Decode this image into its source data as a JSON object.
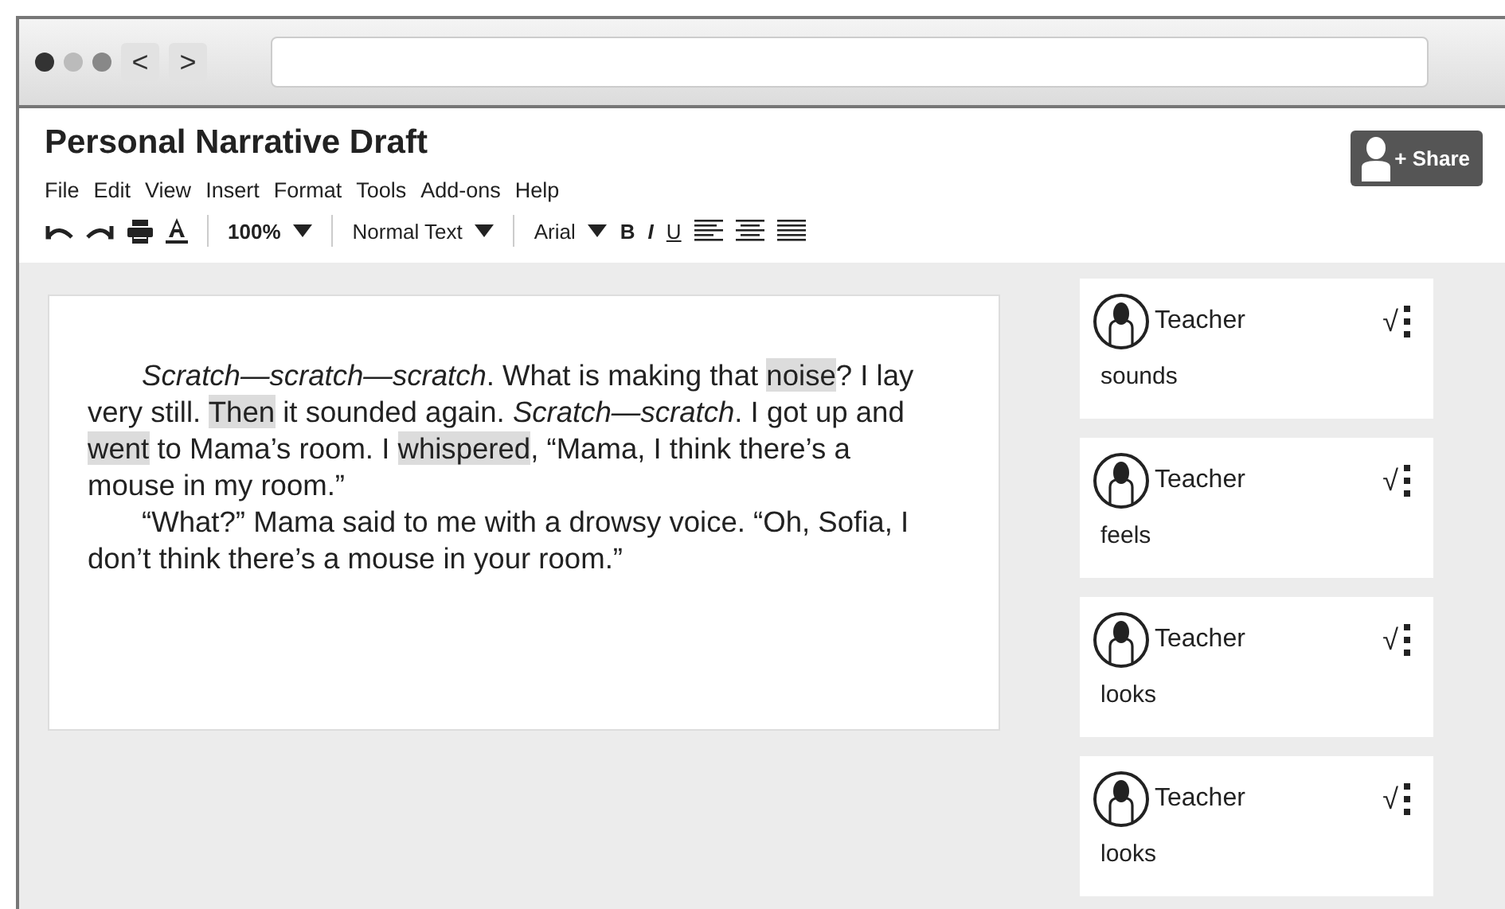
{
  "browser": {
    "back": "<",
    "forward": ">"
  },
  "document": {
    "title": "Personal Narrative Draft",
    "share": "+ Share",
    "menu": [
      "File",
      "Edit",
      "View",
      "Insert",
      "Format",
      "Tools",
      "Add-ons",
      "Help"
    ],
    "toolbar": {
      "zoom": "100%",
      "style": "Normal Text",
      "font": "Arial",
      "bold": "B",
      "italic": "I",
      "underline": "U"
    },
    "paragraphs": [
      [
        {
          "text": "Scratch—scratch—scratch",
          "kind": "italic"
        },
        {
          "text": ". What is making that ",
          "kind": "plain"
        },
        {
          "text": "noise",
          "kind": "highlight"
        },
        {
          "text": "? I lay very still. ",
          "kind": "plain"
        },
        {
          "text": "Then",
          "kind": "highlight"
        },
        {
          "text": " it sounded again. ",
          "kind": "plain"
        },
        {
          "text": "Scratch—scratch",
          "kind": "italic"
        },
        {
          "text": ". I got up and ",
          "kind": "plain"
        },
        {
          "text": "went",
          "kind": "highlight"
        },
        {
          "text": " to Mama’s room. I ",
          "kind": "plain"
        },
        {
          "text": "whispered",
          "kind": "highlight"
        },
        {
          "text": ", “Mama, I think there’s a mouse in my room.”",
          "kind": "plain"
        }
      ],
      [
        {
          "text": "“What?” Mama said to me with a drowsy voice. “Oh, Sofia, I don’t think there’s a mouse in your room.”",
          "kind": "plain"
        }
      ]
    ]
  },
  "comments": [
    {
      "author": "Teacher",
      "resolve": "√",
      "text": "sounds"
    },
    {
      "author": "Teacher",
      "resolve": "√",
      "text": "feels"
    },
    {
      "author": "Teacher",
      "resolve": "√",
      "text": "looks"
    },
    {
      "author": "Teacher",
      "resolve": "√",
      "text": "looks"
    }
  ]
}
